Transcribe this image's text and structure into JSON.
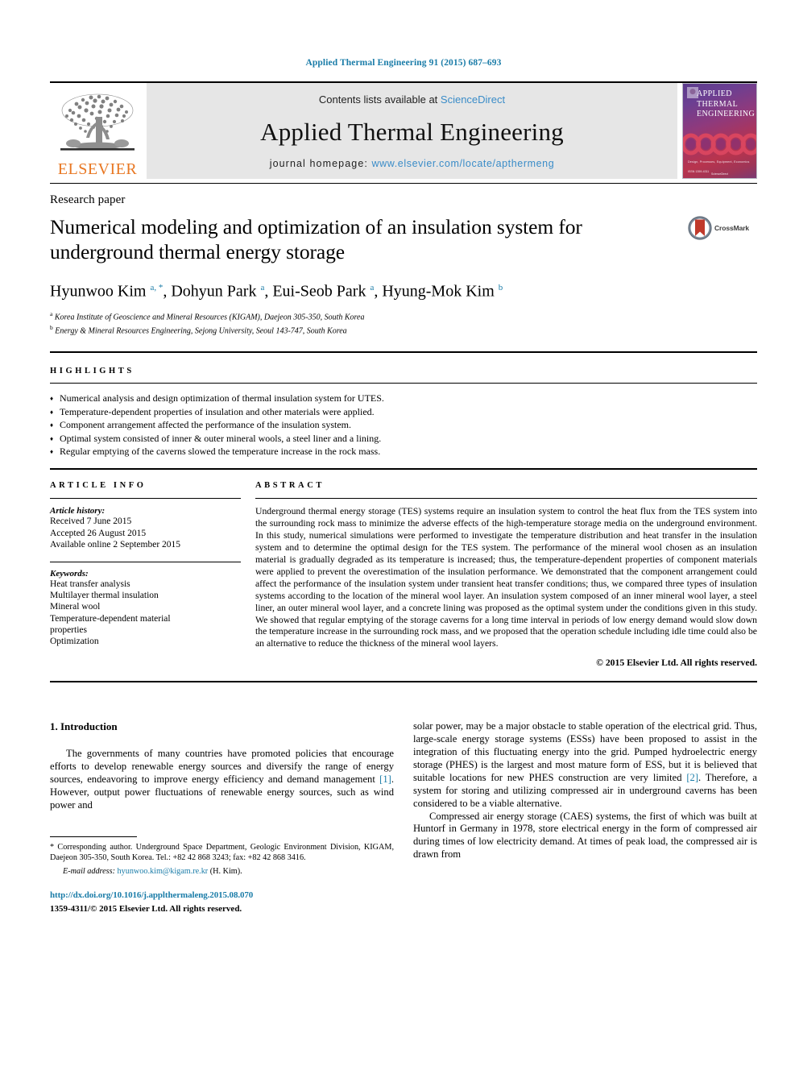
{
  "running_head": "Applied Thermal Engineering 91 (2015) 687–693",
  "masthead": {
    "publisher": "ELSEVIER",
    "contents_prefix": "Contents lists available at ",
    "contents_link": "ScienceDirect",
    "journal_title": "Applied Thermal Engineering",
    "homepage_label": "journal homepage: ",
    "homepage_url": "www.elsevier.com/locate/apthermeng",
    "cover": {
      "line1": "APPLIED",
      "line2": "THERMAL",
      "line3": "ENGINEERING",
      "footer_text": "Design, Processes, Equipment, Economics",
      "issn_text": "ISSN 1359-4311",
      "bottom_text": "ScienceDirect"
    }
  },
  "article": {
    "type": "Research paper",
    "title": "Numerical modeling and optimization of an insulation system for underground thermal energy storage",
    "crossmark_label": "CrossMark",
    "authors_html": "Hyunwoo Kim <sup>a, *</sup>, Dohyun Park <sup>a</sup>, Eui-Seob Park <sup>a</sup>, Hyung-Mok Kim <sup>b</sup>",
    "affiliations": [
      "Korea Institute of Geoscience and Mineral Resources (KIGAM), Daejeon 305-350, South Korea",
      "Energy & Mineral Resources Engineering, Sejong University, Seoul 143-747, South Korea"
    ],
    "affiliation_marks": [
      "a",
      "b"
    ]
  },
  "highlights": {
    "label": "HIGHLIGHTS",
    "items": [
      "Numerical analysis and design optimization of thermal insulation system for UTES.",
      "Temperature-dependent properties of insulation and other materials were applied.",
      "Component arrangement affected the performance of the insulation system.",
      "Optimal system consisted of inner & outer mineral wools, a steel liner and a lining.",
      "Regular emptying of the caverns slowed the temperature increase in the rock mass."
    ]
  },
  "article_info": {
    "label": "ARTICLE INFO",
    "history_head": "Article history:",
    "history": [
      "Received 7 June 2015",
      "Accepted 26 August 2015",
      "Available online 2 September 2015"
    ],
    "keywords_head": "Keywords:",
    "keywords": [
      "Heat transfer analysis",
      "Multilayer thermal insulation",
      "Mineral wool",
      "Temperature-dependent material",
      "properties",
      "Optimization"
    ]
  },
  "abstract": {
    "label": "ABSTRACT",
    "body": "Underground thermal energy storage (TES) systems require an insulation system to control the heat flux from the TES system into the surrounding rock mass to minimize the adverse effects of the high-temperature storage media on the underground environment. In this study, numerical simulations were performed to investigate the temperature distribution and heat transfer in the insulation system and to determine the optimal design for the TES system. The performance of the mineral wool chosen as an insulation material is gradually degraded as its temperature is increased; thus, the temperature-dependent properties of component materials were applied to prevent the overestimation of the insulation performance. We demonstrated that the component arrangement could affect the performance of the insulation system under transient heat transfer conditions; thus, we compared three types of insulation systems according to the location of the mineral wool layer. An insulation system composed of an inner mineral wool layer, a steel liner, an outer mineral wool layer, and a concrete lining was proposed as the optimal system under the conditions given in this study. We showed that regular emptying of the storage caverns for a long time interval in periods of low energy demand would slow down the temperature increase in the surrounding rock mass, and we proposed that the operation schedule including idle time could also be an alternative to reduce the thickness of the mineral wool layers.",
    "copyright": "© 2015 Elsevier Ltd. All rights reserved."
  },
  "body": {
    "section_heading": "1. Introduction",
    "left_paragraphs": [
      "The governments of many countries have promoted policies that encourage efforts to develop renewable energy sources and diversify the range of energy sources, endeavoring to improve energy efficiency and demand management [1]. However, output power fluctuations of renewable energy sources, such as wind power and"
    ],
    "right_paragraphs": [
      "solar power, may be a major obstacle to stable operation of the electrical grid. Thus, large-scale energy storage systems (ESSs) have been proposed to assist in the integration of this fluctuating energy into the grid. Pumped hydroelectric energy storage (PHES) is the largest and most mature form of ESS, but it is believed that suitable locations for new PHES construction are very limited [2]. Therefore, a system for storing and utilizing compressed air in underground caverns has been considered to be a viable alternative.",
      "Compressed air energy storage (CAES) systems, the first of which was built at Huntorf in Germany in 1978, store electrical energy in the form of compressed air during times of low electricity demand. At times of peak load, the compressed air is drawn from"
    ],
    "citation_refs": [
      "[1]",
      "[2]"
    ]
  },
  "footnote": {
    "corresponding": "* Corresponding author. Underground Space Department, Geologic Environment Division, KIGAM, Daejeon 305-350, South Korea. Tel.: +82 42 868 3243; fax: +82 42 868 3416.",
    "email_label": "E-mail address:",
    "email": "hyunwoo.kim@kigam.re.kr",
    "email_suffix": "(H. Kim)."
  },
  "doi_block": {
    "doi": "http://dx.doi.org/10.1016/j.applthermaleng.2015.08.070",
    "issn_line": "1359-4311/© 2015 Elsevier Ltd. All rights reserved."
  },
  "colors": {
    "link": "#1a7ca8",
    "banner_bg": "#e6e6e6",
    "elsevier_orange": "#e87722",
    "crossmark_red": "#c0392b"
  }
}
